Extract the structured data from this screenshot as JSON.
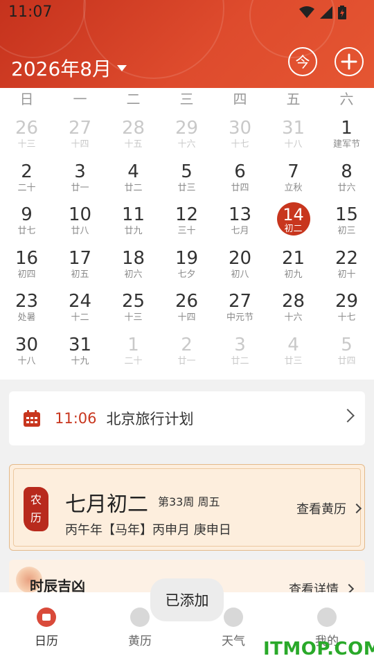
{
  "status_bar": {
    "time": "11:07"
  },
  "header": {
    "month_title": "2026年8月",
    "today_label": "今"
  },
  "colors": {
    "accent": "#c8361e",
    "header": "#de4b2d",
    "almanac_bg": "#fdeedd"
  },
  "calendar": {
    "weekdays": [
      "日",
      "一",
      "二",
      "三",
      "四",
      "五",
      "六"
    ],
    "days": [
      {
        "n": "26",
        "l": "十三",
        "dim": true
      },
      {
        "n": "27",
        "l": "十四",
        "dim": true
      },
      {
        "n": "28",
        "l": "十五",
        "dim": true
      },
      {
        "n": "29",
        "l": "十六",
        "dim": true
      },
      {
        "n": "30",
        "l": "十七",
        "dim": true
      },
      {
        "n": "31",
        "l": "十八",
        "dim": true
      },
      {
        "n": "1",
        "l": "建军节"
      },
      {
        "n": "2",
        "l": "二十"
      },
      {
        "n": "3",
        "l": "廿一"
      },
      {
        "n": "4",
        "l": "廿二"
      },
      {
        "n": "5",
        "l": "廿三"
      },
      {
        "n": "6",
        "l": "廿四"
      },
      {
        "n": "7",
        "l": "立秋"
      },
      {
        "n": "8",
        "l": "廿六"
      },
      {
        "n": "9",
        "l": "廿七"
      },
      {
        "n": "10",
        "l": "廿八"
      },
      {
        "n": "11",
        "l": "廿九"
      },
      {
        "n": "12",
        "l": "三十"
      },
      {
        "n": "13",
        "l": "七月"
      },
      {
        "n": "14",
        "l": "初二",
        "selected": true
      },
      {
        "n": "15",
        "l": "初三"
      },
      {
        "n": "16",
        "l": "初四"
      },
      {
        "n": "17",
        "l": "初五"
      },
      {
        "n": "18",
        "l": "初六"
      },
      {
        "n": "19",
        "l": "七夕"
      },
      {
        "n": "20",
        "l": "初八"
      },
      {
        "n": "21",
        "l": "初九"
      },
      {
        "n": "22",
        "l": "初十"
      },
      {
        "n": "23",
        "l": "处暑"
      },
      {
        "n": "24",
        "l": "十二"
      },
      {
        "n": "25",
        "l": "十三"
      },
      {
        "n": "26",
        "l": "十四"
      },
      {
        "n": "27",
        "l": "中元节"
      },
      {
        "n": "28",
        "l": "十六"
      },
      {
        "n": "29",
        "l": "十七"
      },
      {
        "n": "30",
        "l": "十八"
      },
      {
        "n": "31",
        "l": "十九"
      },
      {
        "n": "1",
        "l": "二十",
        "dim": true
      },
      {
        "n": "2",
        "l": "廿一",
        "dim": true
      },
      {
        "n": "3",
        "l": "廿二",
        "dim": true
      },
      {
        "n": "4",
        "l": "廿三",
        "dim": true
      },
      {
        "n": "5",
        "l": "廿四",
        "dim": true
      }
    ]
  },
  "event": {
    "time": "11:06",
    "title": "北京旅行计划"
  },
  "almanac": {
    "seal_chars": [
      "农",
      "历"
    ],
    "lunar_date": "七月初二",
    "week_info": "第33周 周五",
    "ganzhi": "丙午年【马年】丙申月 庚申日",
    "link_label": "查看黄历"
  },
  "hours": {
    "title": "时辰吉凶",
    "link_label": "查看详情"
  },
  "toast": "已添加",
  "nav": [
    {
      "label": "日历",
      "active": true
    },
    {
      "label": "黄历"
    },
    {
      "label": "天气"
    },
    {
      "label": "我的"
    }
  ],
  "watermark": "ITMOP.COM"
}
